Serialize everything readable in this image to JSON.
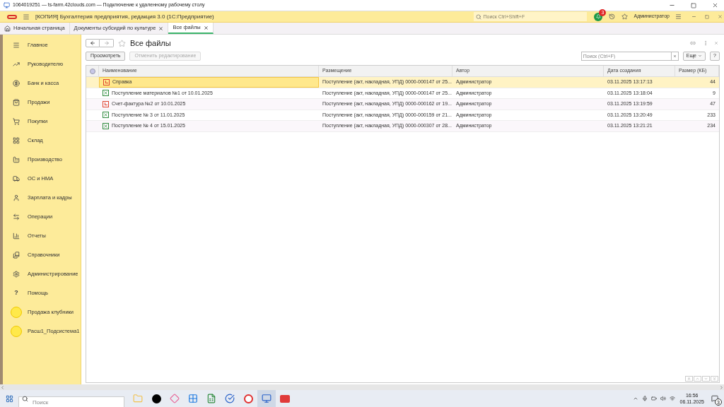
{
  "rdp_window": {
    "title": "1064019251 — ts-farm.42clouds.com — Подключение к удаленному рабочему столу"
  },
  "app_header": {
    "title": "[КОПИЯ] Бухгалтерия предприятия, редакция 3.0  (1С:Предприятие)",
    "search": {
      "placeholder": "Поиск Ctrl+Shift+F"
    },
    "notifications_badge": "3",
    "user": "Администратор"
  },
  "tabs": [
    {
      "label": "Начальная страница",
      "selected": false,
      "closable": false
    },
    {
      "label": "Документы субсидий по культуре",
      "selected": false,
      "closable": true
    },
    {
      "label": "Все файлы",
      "selected": true,
      "closable": true
    }
  ],
  "sidebar": {
    "items": [
      {
        "label": "Главное",
        "kind": "section"
      },
      {
        "label": "Руководителю",
        "kind": "section"
      },
      {
        "label": "Банк и касса",
        "kind": "section"
      },
      {
        "label": "Продажи",
        "kind": "section"
      },
      {
        "label": "Покупки",
        "kind": "section"
      },
      {
        "label": "Склад",
        "kind": "section"
      },
      {
        "label": "Производство",
        "kind": "section"
      },
      {
        "label": "ОС и НМА",
        "kind": "section"
      },
      {
        "label": "Зарплата и кадры",
        "kind": "section"
      },
      {
        "label": "Операции",
        "kind": "section"
      },
      {
        "label": "Отчеты",
        "kind": "section"
      },
      {
        "label": "Справочники",
        "kind": "section"
      },
      {
        "label": "Администрирование",
        "kind": "section"
      },
      {
        "label": "Помощь",
        "kind": "help",
        "icon_text": "?"
      },
      {
        "label": "Продажа клубники",
        "kind": "subsystem"
      },
      {
        "label": "Расш1_Подсистема1",
        "kind": "subsystem"
      }
    ]
  },
  "form": {
    "title": "Все файлы",
    "buttons": [
      {
        "label": "Просмотреть",
        "disabled": false
      },
      {
        "label": "Отменить редактирование",
        "disabled": true
      }
    ],
    "search": {
      "placeholder": "Поиск (Ctrl+F)"
    },
    "more_button": "Еще",
    "help_button": "?",
    "table": {
      "columns": [
        "Наименование",
        "Размещение",
        "Автор",
        "Дата создания",
        "Размер (КБ)"
      ],
      "rows": [
        {
          "kind": "pdf",
          "selected": true,
          "cells": [
            "Справка",
            "Поступление (акт, накладная, УПД) 0000-000147 от 25...",
            "Администратор",
            "03.11.2025 13:17:13",
            "44"
          ]
        },
        {
          "kind": "xlsx",
          "selected": false,
          "cells": [
            "Поступление материалов №1 от 10.01.2025",
            "Поступление (акт, накладная, УПД) 0000-000147 от 25...",
            "Администратор",
            "03.11.2025 13:18:04",
            "9"
          ]
        },
        {
          "kind": "pdf",
          "selected": false,
          "cells": [
            "Счет-фактура №2 от 10.01.2025",
            "Поступление (акт, накладная, УПД) 0000-000162 от 19...",
            "Администратор",
            "03.11.2025 13:19:59",
            "47"
          ]
        },
        {
          "kind": "xlsx",
          "selected": false,
          "cells": [
            "Поступление № 3 от 11.01.2025",
            "Поступление (акт, накладная, УПД) 0000-000159 от 21...",
            "Администратор",
            "03.11.2025 13:20:49",
            "233"
          ]
        },
        {
          "kind": "xlsx",
          "selected": false,
          "cells": [
            "Поступление № 4 от 15.01.2025",
            "Поступление (акт, накладная, УПД) 0000-000307 от 28...",
            "Администратор",
            "03.11.2025 13:21:21",
            "234"
          ]
        }
      ]
    }
  },
  "taskbar": {
    "search": {
      "placeholder": "Поиск"
    },
    "apps": [
      {
        "kind": "folder"
      },
      {
        "kind": "v2"
      },
      {
        "kind": "diamond"
      },
      {
        "kind": "grid"
      },
      {
        "kind": "chart"
      },
      {
        "kind": "check"
      },
      {
        "kind": "browser"
      },
      {
        "kind": "remote"
      },
      {
        "kind": "red"
      }
    ],
    "time": "16:56",
    "date": "06.11.2025",
    "notifications": "3"
  }
}
